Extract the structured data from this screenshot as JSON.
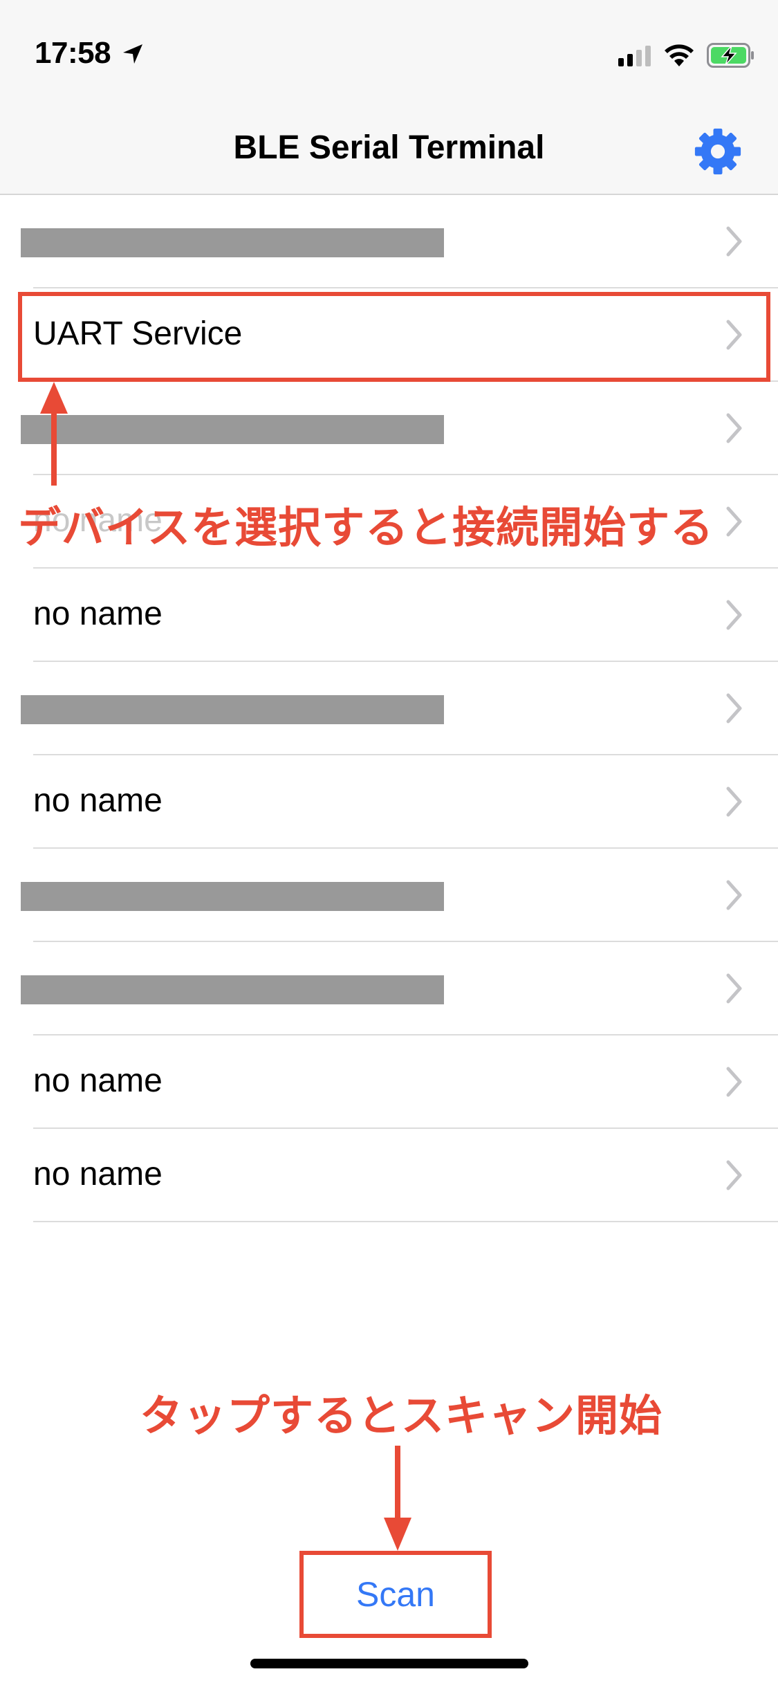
{
  "status_bar": {
    "time": "17:58",
    "location_icon": "location-arrow-icon",
    "signal_icon": "cellular-signal-icon",
    "wifi_icon": "wifi-icon",
    "battery_icon": "battery-charging-icon"
  },
  "nav": {
    "title": "BLE Serial Terminal",
    "settings_icon": "gear-icon",
    "accent": "#3478f6"
  },
  "devices": [
    {
      "label": "",
      "redacted": true
    },
    {
      "label": "UART Service",
      "redacted": false,
      "highlighted": true
    },
    {
      "label": "",
      "redacted": true
    },
    {
      "label": "no name",
      "redacted": false,
      "obscured": true
    },
    {
      "label": "no name",
      "redacted": false
    },
    {
      "label": "",
      "redacted": true
    },
    {
      "label": "no name",
      "redacted": false
    },
    {
      "label": "",
      "redacted": true
    },
    {
      "label": "",
      "redacted": true
    },
    {
      "label": "no name",
      "redacted": false
    },
    {
      "label": "no name",
      "redacted": false
    }
  ],
  "annotations": {
    "select_device": "デバイスを選択すると接続開始する",
    "tap_scan": "タップするとスキャン開始",
    "color": "#e84a36"
  },
  "scan_button": {
    "label": "Scan"
  }
}
